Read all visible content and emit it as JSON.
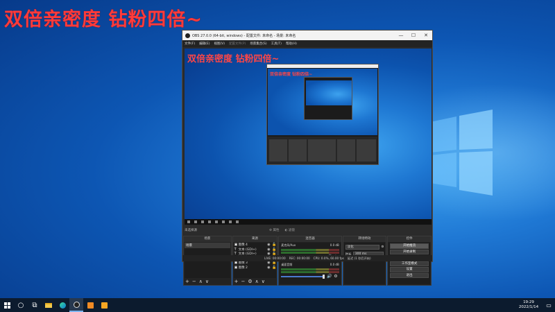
{
  "desktop": {
    "overlay_text": "双倍亲密度 钻粉四倍~"
  },
  "obs": {
    "title": "OBS 27.0.0 (64-bit, windows) - 配置文件: 未命名 - 场景: 未命名",
    "window_buttons": [
      "—",
      "☐",
      "✕"
    ],
    "menu": [
      {
        "label": "文件(F)",
        "enabled": true
      },
      {
        "label": "编辑(E)",
        "enabled": true
      },
      {
        "label": "视图(V)",
        "enabled": true
      },
      {
        "label": "配置文件(P)",
        "enabled": false
      },
      {
        "label": "场景集合(S)",
        "enabled": true
      },
      {
        "label": "工具(T)",
        "enabled": true
      },
      {
        "label": "帮助(H)",
        "enabled": true
      }
    ],
    "preview_overlay": "双倍亲密度 钻粉四倍~",
    "source_bar": {
      "label": "未选择源",
      "properties": "属性",
      "filters": "滤镜"
    },
    "docks": {
      "scenes": {
        "title": "场景",
        "items": [
          "场景"
        ],
        "footer": [
          "+",
          "−",
          "∧",
          "∨"
        ]
      },
      "sources": {
        "title": "来源",
        "items": [
          {
            "icon": "image-icon",
            "glyph": "▣",
            "name": "图像 4"
          },
          {
            "icon": "text-icon",
            "glyph": "T",
            "name": "文本 (GDI+)"
          },
          {
            "icon": "text-icon",
            "glyph": "T",
            "name": "文本 (GDI+)"
          },
          {
            "icon": "text-icon",
            "glyph": "T",
            "name": "文本"
          },
          {
            "icon": "image-icon",
            "glyph": "▣",
            "name": "图像 3"
          },
          {
            "icon": "image-icon",
            "glyph": "▣",
            "name": "图像 2"
          }
        ],
        "footer": [
          "+",
          "−",
          "⚙",
          "∧",
          "∨"
        ]
      },
      "mixer": {
        "title": "混音器",
        "channels": [
          {
            "name": "麦克风/Aux",
            "db": "0.0 dB",
            "volume": 1.0
          },
          {
            "name": "桌面音频",
            "db": "0.0 dB",
            "volume": 1.0
          }
        ]
      },
      "transitions": {
        "title": "转场特效",
        "selected": "淡化",
        "duration_label": "时长",
        "duration_value": "300 ms"
      },
      "controls": {
        "title": "控件",
        "buttons": [
          "开始推流",
          "开始录制",
          "启动虚拟摄像机",
          "工作室模式",
          "设置",
          "退出"
        ]
      }
    },
    "status": {
      "live": "LIVE: 00:00:00",
      "rec": "REC: 00:00:00",
      "cpu": "CPU: 0.0%, 60.00 fps",
      "delay": "延迟 (1 秒后开始)"
    }
  },
  "taskbar": {
    "time": "19:29",
    "date": "2022/1/14"
  },
  "colors": {
    "overlay_red": "#ff3b3b",
    "obs_bg": "#2b2b2b",
    "taskbar": "#0c1b2e"
  }
}
